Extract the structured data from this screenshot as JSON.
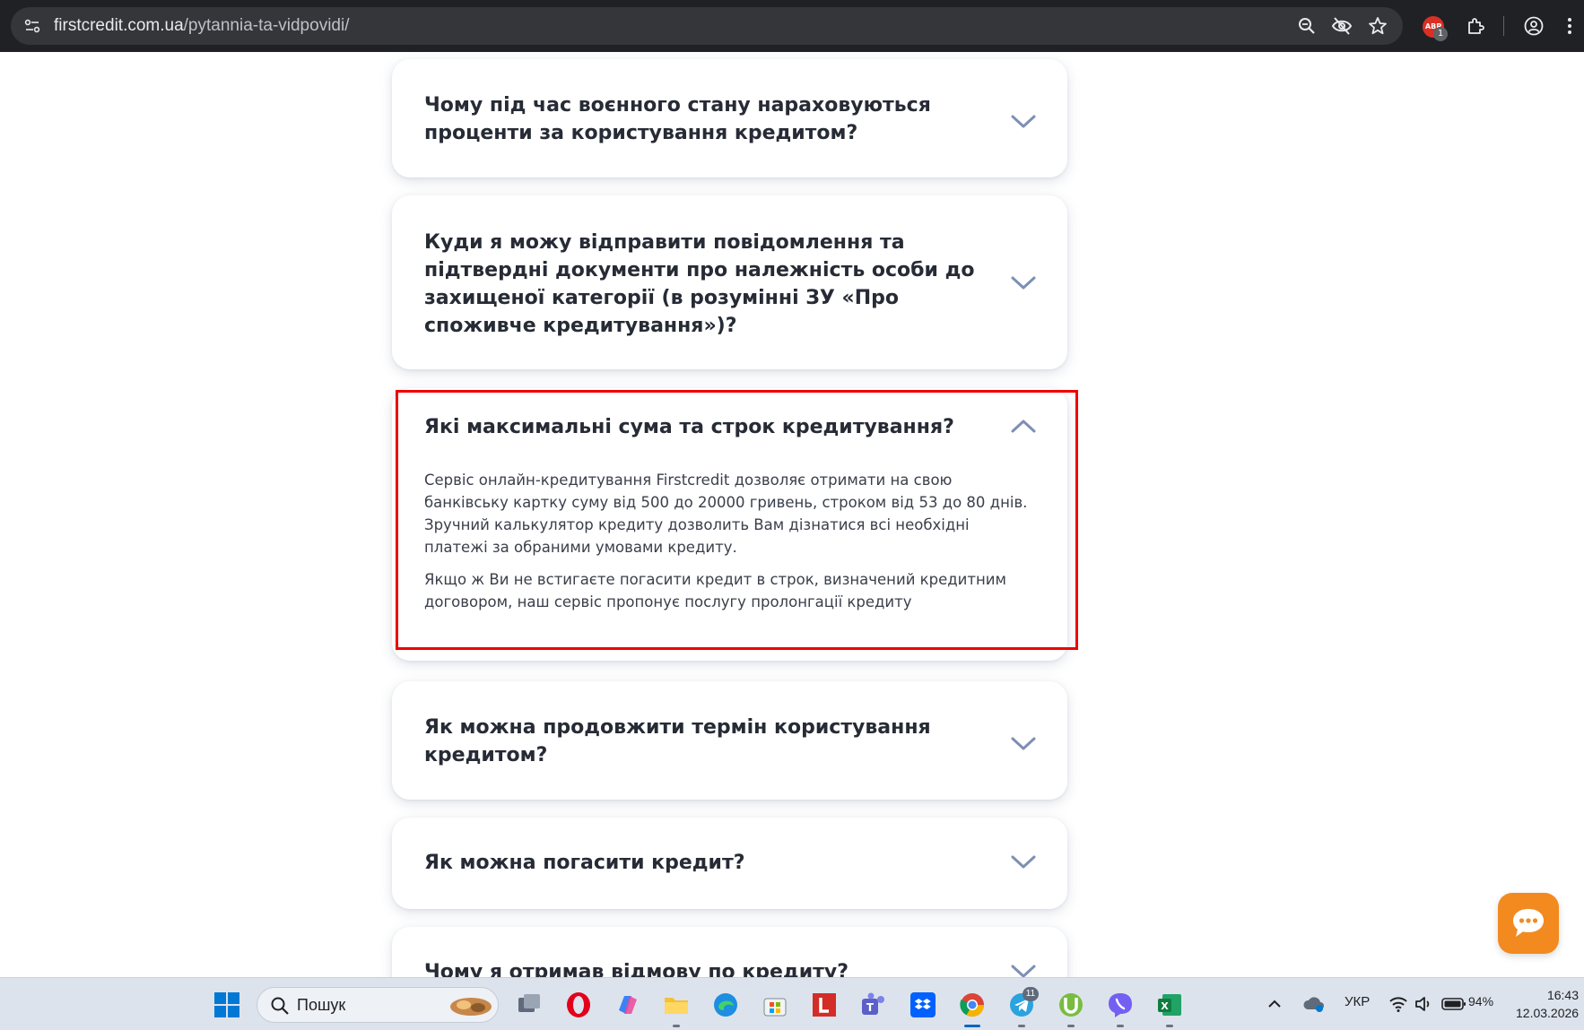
{
  "browser": {
    "url_domain": "firstcredit.com.ua",
    "url_path": "/pytannia-ta-vidpovidi/",
    "extension_badge": "ABP",
    "extension_badge_count": "1"
  },
  "faq": [
    {
      "question": "Чому під час воєнного стану нараховуються проценти за користування кредитом?",
      "expanded": false
    },
    {
      "question": "Куди я можу відправити повідомлення та підтвердні документи про належність особи до захищеної категорії (в розумінні ЗУ «Про споживче кредитування»)?",
      "expanded": false
    },
    {
      "question": "Які максимальні сума та строк кредитування?",
      "expanded": true,
      "answer": [
        "Сервіс онлайн-кредитування Firstcredit дозволяє отримати на свою банківську картку суму від 500 до 20000 гривень, строком від 53 до 80 днів. Зручний калькулятор кредиту дозволить Вам дізнатися всі необхідні платежі за обраними умовами кредиту.",
        "Якщо ж Ви не встигаєте погасити кредит в строк, визначений кредитним договором, наш сервіс пропонує послугу пролонгації кредиту"
      ]
    },
    {
      "question": "Як можна продовжити термін користування кредитом?",
      "expanded": false
    },
    {
      "question": "Як можна погасити кредит?",
      "expanded": false
    },
    {
      "question": "Чому я отримав відмову по кредиту?",
      "expanded": false
    }
  ],
  "colors": {
    "highlight": "#ee0000",
    "chevron": "#7d8fb3",
    "chat_button": "#f28a1f"
  },
  "taskbar": {
    "search_label": "Пошук",
    "telegram_badge": "11",
    "language": "УКР",
    "battery": "94%",
    "time": "16:43",
    "date": "12.03.2026"
  }
}
